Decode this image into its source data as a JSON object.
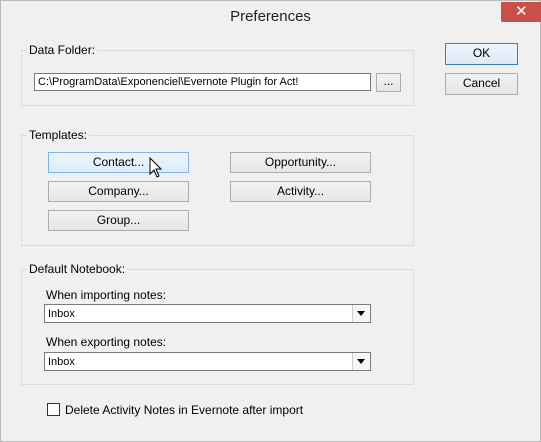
{
  "window": {
    "title": "Preferences"
  },
  "buttons": {
    "ok": "OK",
    "cancel": "Cancel"
  },
  "data_folder": {
    "label": "Data Folder:",
    "path": "C:\\ProgramData\\Exponenciel\\Evernote Plugin for Act!",
    "browse": "..."
  },
  "templates": {
    "label": "Templates:",
    "contact": "Contact...",
    "company": "Company...",
    "group": "Group...",
    "opportunity": "Opportunity...",
    "activity": "Activity..."
  },
  "default_notebook": {
    "label": "Default Notebook:",
    "importing_label": "When importing notes:",
    "importing_value": "Inbox",
    "exporting_label": "When exporting notes:",
    "exporting_value": "Inbox"
  },
  "delete_option": {
    "label": "Delete Activity Notes in Evernote after import",
    "checked": false
  }
}
